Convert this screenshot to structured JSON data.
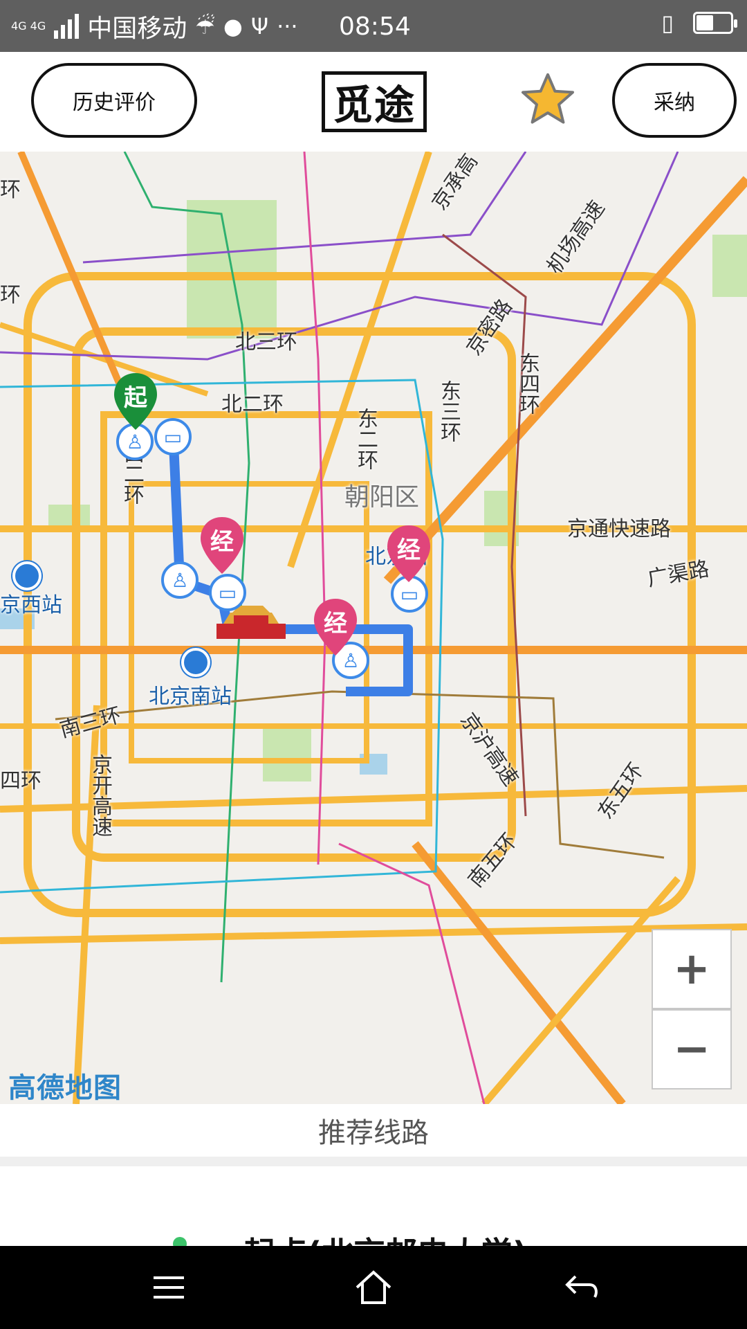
{
  "status_bar": {
    "network": "4G 4G",
    "carrier": "中国移动",
    "time": "08:54",
    "icons": [
      "signal-icon",
      "weather-rain-icon",
      "cat-icon",
      "usb-icon",
      "more-icon",
      "vibrate-icon",
      "battery-icon"
    ],
    "battery_level": 0.5
  },
  "header": {
    "history_label": "历史评价",
    "logo_text": "觅途",
    "favorite_icon": "star-icon",
    "adopt_label": "采纳"
  },
  "map": {
    "roads": {
      "north3": "北三环",
      "north2": "北二环",
      "west2": "西二环",
      "east2": "东二环",
      "east3": "东三环",
      "east4": "东四环",
      "east5": "东五环",
      "south3": "南三环",
      "south5": "南五环",
      "west4": "四环",
      "west_ring": "环",
      "west_ring2": "环",
      "jingtong": "京通快速路",
      "guangqu": "广渠路",
      "jingmi": "京密路",
      "jicheng": "京承高",
      "airport": "机场高速",
      "jinghu": "京沪高速",
      "jingkai": "京开高速"
    },
    "places": {
      "chaoyang": "朝阳区",
      "beijing_station": "北京站",
      "beijing_west": "京西站",
      "beijing_south": "北京南站"
    },
    "pins": {
      "start": "起",
      "via1": "经",
      "via2": "经",
      "via3": "经"
    },
    "colors": {
      "route": "#3d7fe6",
      "start_pin": "#1a8f3a",
      "via_pin": "#e0457b",
      "major_road": "#f7b93b",
      "minor_road": "#fde08a"
    },
    "zoom_in": "+",
    "zoom_out": "−",
    "attribution": "高德地图"
  },
  "recommend": {
    "title": "推荐线路"
  },
  "route": {
    "start_label": "起点(北京邮电大学)"
  },
  "navbar": {
    "icons": [
      "menu-icon",
      "home-icon",
      "back-icon"
    ]
  }
}
